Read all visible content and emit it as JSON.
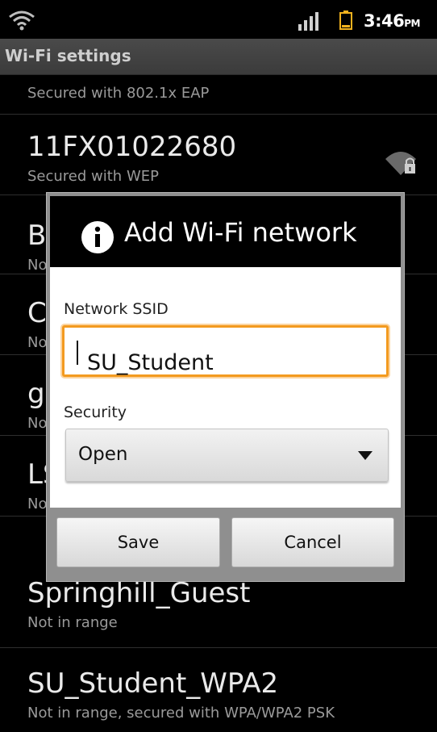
{
  "status_bar": {
    "time": "3:46",
    "ampm": "PM",
    "icons": [
      "wifi-icon",
      "signal-icon",
      "battery-icon"
    ]
  },
  "title_bar": {
    "title": "Wi-Fi settings"
  },
  "networks": [
    {
      "name": "",
      "subtitle": "Secured with 802.1x EAP"
    },
    {
      "name": "11FX01022680",
      "subtitle": "Secured with WEP",
      "icon": "wifi-lock-icon"
    },
    {
      "name": "B",
      "subtitle": "No"
    },
    {
      "name": "C",
      "subtitle": "No"
    },
    {
      "name": "g",
      "subtitle": "No"
    },
    {
      "name": "LS",
      "subtitle": "No"
    },
    {
      "name": "Springhill_Guest",
      "subtitle": "Not in range"
    },
    {
      "name": "SU_Student_WPA2",
      "subtitle": "Not in range, secured with WPA/WPA2 PSK"
    }
  ],
  "dialog": {
    "title": "Add Wi-Fi network",
    "icon": "info-icon",
    "ssid_label": "Network SSID",
    "ssid_value": "SU_Student",
    "security_label": "Security",
    "security_value": "Open",
    "save_label": "Save",
    "cancel_label": "Cancel"
  },
  "colors": {
    "accent_focus": "#f39a1f",
    "background": "#000000",
    "title_bar": "#434343"
  }
}
